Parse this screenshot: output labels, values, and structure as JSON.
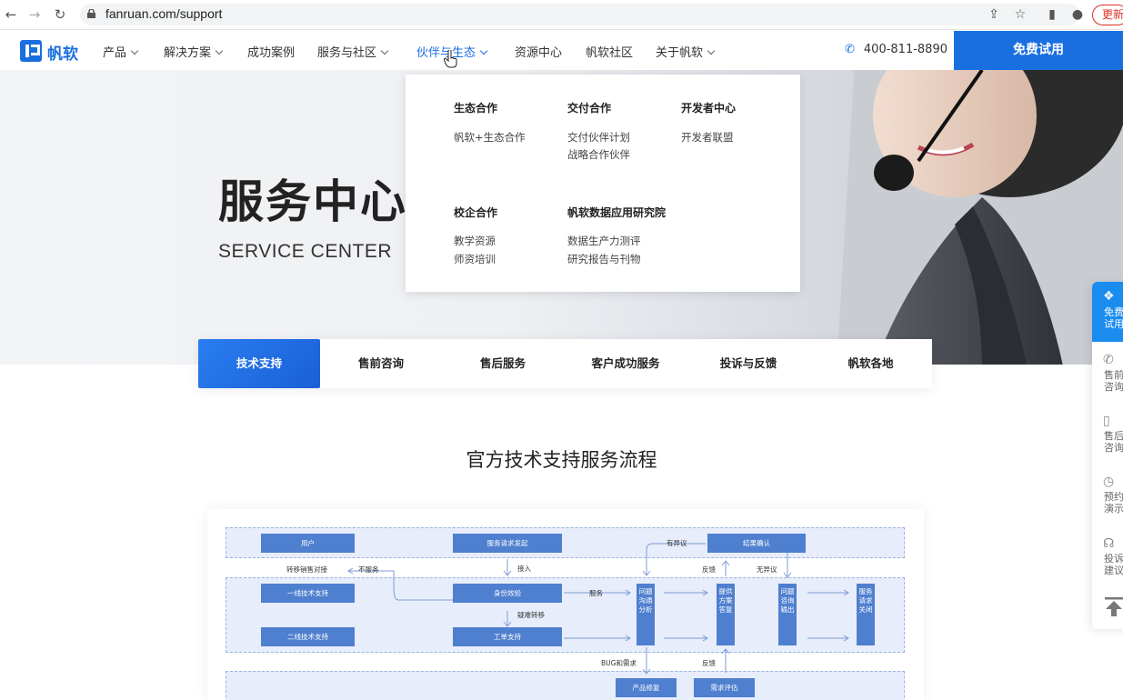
{
  "browser": {
    "url": "fanruan.com/support",
    "update_label": "更新"
  },
  "nav": {
    "logo_text": "帆软",
    "items": [
      "产品",
      "解决方案",
      "成功案例",
      "服务与社区",
      "伙伴与生态",
      "资源中心",
      "帆软社区",
      "关于帆软"
    ],
    "active_item": "伙伴与生态",
    "phone": "400-811-8890",
    "trial_label": "免费试用"
  },
  "hero": {
    "title": "服务中心",
    "subtitle": "SERVICE CENTER"
  },
  "dropdown": {
    "groups": [
      {
        "heading": "生态合作",
        "links": [
          "帆软+生态合作"
        ]
      },
      {
        "heading": "交付合作",
        "links": [
          "交付伙伴计划",
          "战略合作伙伴"
        ]
      },
      {
        "heading": "开发者中心",
        "links": [
          "开发者联盟"
        ]
      },
      {
        "heading": "校企合作",
        "links": [
          "教学资源",
          "师资培训"
        ]
      },
      {
        "heading": "帆软数据应用研究院",
        "links": [
          "数据生产力测评",
          "研究报告与刊物"
        ]
      }
    ]
  },
  "tabs": [
    "技术支持",
    "售前咨询",
    "售后服务",
    "客户成功服务",
    "投诉与反馈",
    "帆软各地"
  ],
  "active_tab": "技术支持",
  "float_bar": {
    "top": "免费试用",
    "items": [
      "售前咨询",
      "售后咨询",
      "预约演示",
      "投诉建议"
    ]
  },
  "section_title": "官方技术支持服务流程",
  "flow": {
    "boxes": {
      "user": "用户",
      "request": "服务请求发起",
      "result": "结果确认",
      "tier1": "一线技术支持",
      "identity": "身份效验",
      "tier2": "二线技术支持",
      "ticket": "工单支持",
      "analyze": "问题沟通分析",
      "solution": "提供方案答复",
      "output": "问题咨询输出",
      "close": "服务请求关闭",
      "product": "产品修复",
      "demand": "需求评估"
    },
    "labels": {
      "dispute": "有异议",
      "transfer_sales": "转移销售对接",
      "no_service": "不服务",
      "access": "接入",
      "feedback": "反馈",
      "no_dispute": "无异议",
      "service": "服务",
      "hard_transfer": "疑难转移",
      "bug_demand": "BUG和需求",
      "feedback2": "反馈"
    }
  },
  "colors": {
    "brand": "#1a6fe0",
    "flow_box": "#4f7fcf",
    "lane_bg": "#e7edfa"
  }
}
